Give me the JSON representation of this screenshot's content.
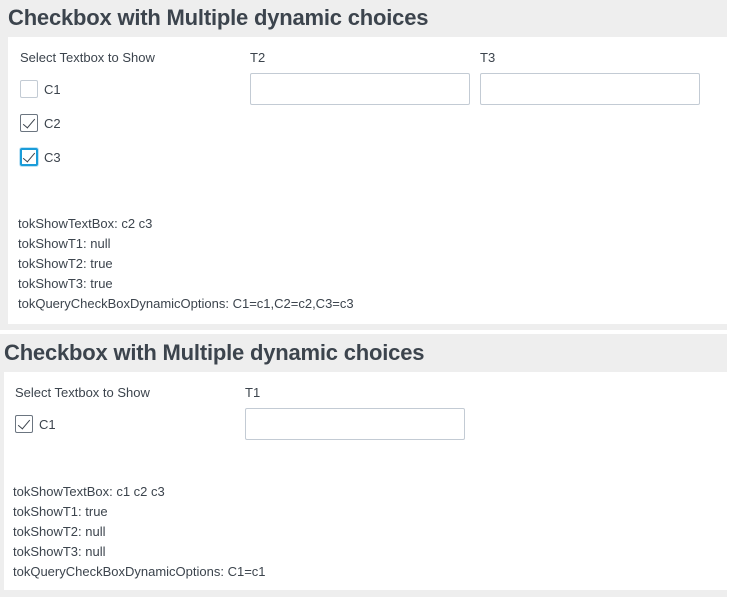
{
  "panel1": {
    "title": "Checkbox with Multiple dynamic choices",
    "checkbox_group_label": "Select Textbox to Show",
    "checkboxes": [
      {
        "label": "C1",
        "checked": false
      },
      {
        "label": "C2",
        "checked": true
      },
      {
        "label": "C3",
        "checked": true,
        "focused": true
      }
    ],
    "textboxes": [
      {
        "label": "T2",
        "value": ""
      },
      {
        "label": "T3",
        "value": ""
      }
    ],
    "tokens": [
      "tokShowTextBox: c2 c3",
      "tokShowT1: null",
      "tokShowT2: true",
      "tokShowT3: true",
      "tokQueryCheckBoxDynamicOptions: C1=c1,C2=c2,C3=c3"
    ]
  },
  "panel2": {
    "title": "Checkbox with Multiple dynamic choices",
    "checkbox_group_label": "Select Textbox to Show",
    "checkboxes": [
      {
        "label": "C1",
        "checked": true
      }
    ],
    "textboxes": [
      {
        "label": "T1",
        "value": ""
      }
    ],
    "tokens": [
      "tokShowTextBox: c1 c2 c3",
      "tokShowT1: true",
      "tokShowT2: null",
      "tokShowT3: null",
      "tokQueryCheckBoxDynamicOptions: C1=c1"
    ]
  },
  "colors": {
    "panel_background": "#eeeeee",
    "text": "#3c444d",
    "border": "#c3cbd4",
    "focus": "#1a9cd9"
  }
}
